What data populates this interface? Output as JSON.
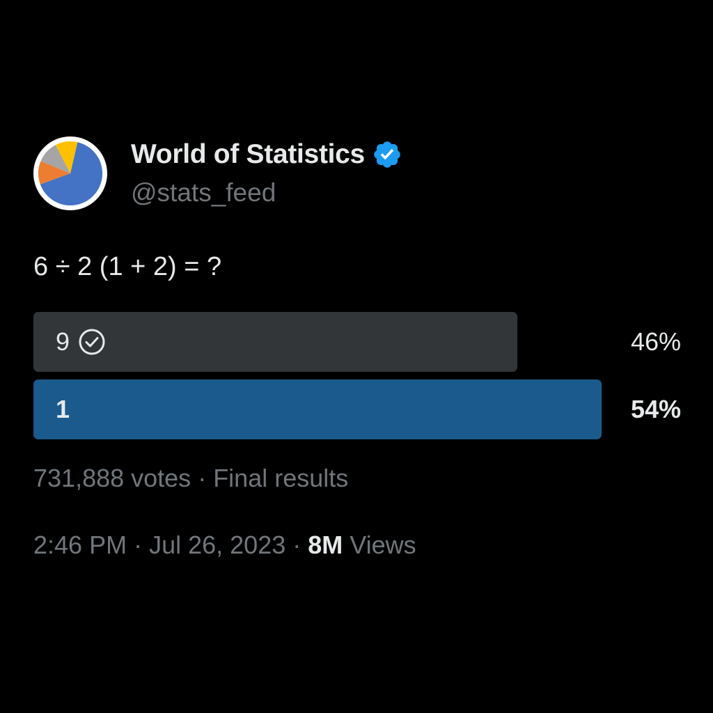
{
  "author": {
    "display_name": "World of Statistics",
    "handle": "@stats_feed",
    "verified_color": "#1d9bf0",
    "avatar_colors": [
      "#4472c4",
      "#ed7d31",
      "#a5a5a5",
      "#ffc000"
    ]
  },
  "tweet": {
    "text": "6 ÷ 2 (1 + 2) = ?"
  },
  "poll": {
    "options": [
      {
        "label": "9",
        "percent_text": "46%",
        "percent": 46,
        "voted": true,
        "winner": false
      },
      {
        "label": "1",
        "percent_text": "54%",
        "percent": 54,
        "voted": false,
        "winner": true
      }
    ],
    "votes": "731,888 votes",
    "separator": " · ",
    "status": "Final results"
  },
  "meta": {
    "time": "2:46 PM",
    "separator": " · ",
    "date": "Jul 26, 2023",
    "views_count": "8M",
    "views_label": " Views"
  },
  "colors": {
    "background": "#000000",
    "text_primary": "#e7e9ea",
    "text_secondary": "#71767b",
    "poll_bar": "#333639",
    "poll_bar_winner": "#1a5a8c",
    "accent": "#1d9bf0"
  }
}
